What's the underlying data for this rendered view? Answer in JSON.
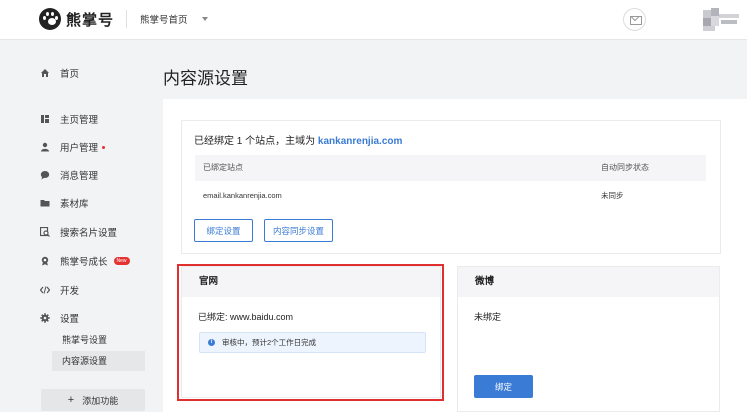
{
  "header": {
    "brand": "熊掌号",
    "account_switch": "熊掌号首页"
  },
  "sidebar": {
    "items": [
      {
        "label": "首页",
        "icon": "home-icon"
      },
      {
        "label": "主页管理",
        "icon": "layout-icon"
      },
      {
        "label": "用户管理",
        "icon": "user-icon"
      },
      {
        "label": "消息管理",
        "icon": "message-icon"
      },
      {
        "label": "素材库",
        "icon": "folder-icon"
      },
      {
        "label": "搜索名片设置",
        "icon": "search-card-icon"
      },
      {
        "label": "熊掌号成长",
        "icon": "growth-icon",
        "badge": "New"
      },
      {
        "label": "开发",
        "icon": "code-icon"
      },
      {
        "label": "设置",
        "icon": "gear-icon"
      }
    ],
    "sub_items": [
      "熊掌号设置",
      "内容源设置"
    ],
    "add_button": "添加功能"
  },
  "main": {
    "page_title": "内容源设置",
    "bind_summary": {
      "prefix": "已经绑定 1 个站点，主域为",
      "domain": "kankanrenjia.com"
    },
    "table": {
      "columns": [
        "已绑定站点",
        "自动同步状态"
      ],
      "rows": [
        [
          "email.kankanrenjia.com",
          "未同步"
        ]
      ]
    },
    "buttons": {
      "bind_settings": "绑定设置",
      "sync_settings": "内容同步设置"
    },
    "official_site": {
      "title": "官网",
      "bound": "已绑定: www.baidu.com",
      "notice": "审核中，预计2个工作日完成"
    },
    "weibo": {
      "title": "微博",
      "status": "未绑定",
      "bind_button": "绑定"
    }
  },
  "colors": {
    "accent": "#3a7bd5",
    "highlight": "#e02f2f",
    "dot": "#e5312f"
  }
}
